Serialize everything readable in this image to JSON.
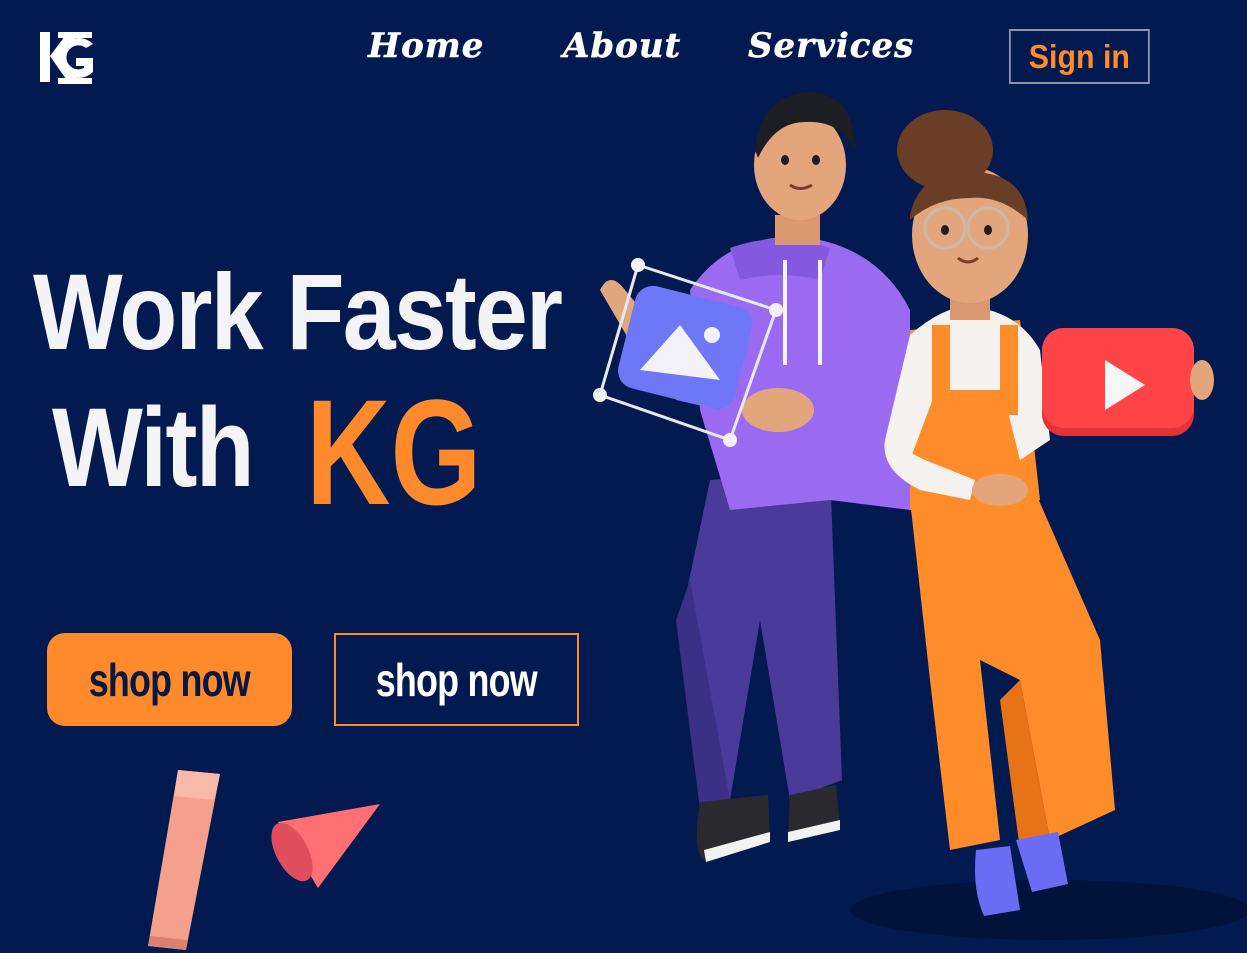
{
  "brand": {
    "logo_text": "KG"
  },
  "nav": {
    "items": [
      {
        "label": "Home"
      },
      {
        "label": "About"
      },
      {
        "label": "Services"
      }
    ],
    "signin_label": "Sign in"
  },
  "hero": {
    "line1": "Work Faster",
    "line2_prefix": "With",
    "brand_highlight": "KG"
  },
  "buttons": {
    "primary_label": "shop now",
    "secondary_label": "shop now"
  },
  "colors": {
    "background": "#021a4f",
    "accent": "#ff8a2c",
    "text": "#f4f4f6"
  },
  "illustration": {
    "icons": [
      "image-icon",
      "play-icon"
    ]
  }
}
